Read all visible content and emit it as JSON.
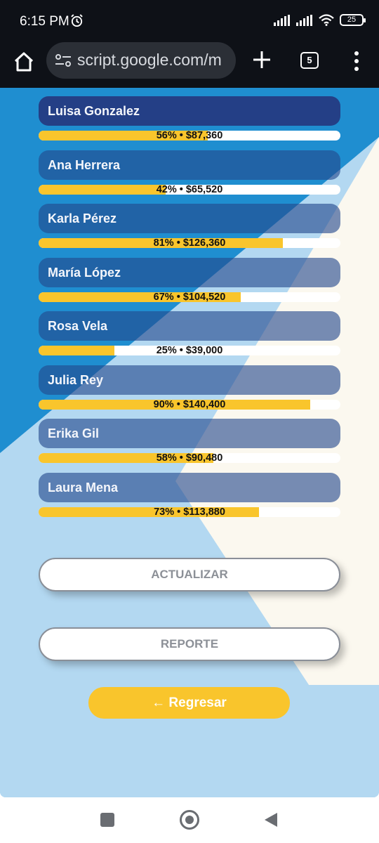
{
  "status_bar": {
    "time": "6:15 PM",
    "battery": "25",
    "icons": [
      "alarm-icon",
      "signal-icon",
      "signal-icon",
      "wifi-icon",
      "battery-icon"
    ]
  },
  "browser": {
    "url": "script.google.com/m",
    "tab_count": "5"
  },
  "vendors": [
    {
      "name": "Luisa Gonzalez",
      "label": "56% • $87,360",
      "percent": 56
    },
    {
      "name": "Ana Herrera",
      "label": "42% • $65,520",
      "percent": 42
    },
    {
      "name": "Karla Pérez",
      "label": "81% • $126,360",
      "percent": 81
    },
    {
      "name": "María López",
      "label": "67% • $104,520",
      "percent": 67
    },
    {
      "name": "Rosa Vela",
      "label": "25% • $39,000",
      "percent": 25
    },
    {
      "name": "Julia Rey",
      "label": "90% • $140,400",
      "percent": 90
    },
    {
      "name": "Erika Gil",
      "label": "58% • $90,480",
      "percent": 58
    },
    {
      "name": "Laura Mena",
      "label": "73% • $113,880",
      "percent": 73
    }
  ],
  "buttons": {
    "actualizar": "ACTUALIZAR",
    "reporte": "REPORTE",
    "regresar": "← Regresar"
  },
  "colors": {
    "accent": "#f9c52c",
    "bar_bg": "#ffffff",
    "name_bg": "#243f86"
  }
}
